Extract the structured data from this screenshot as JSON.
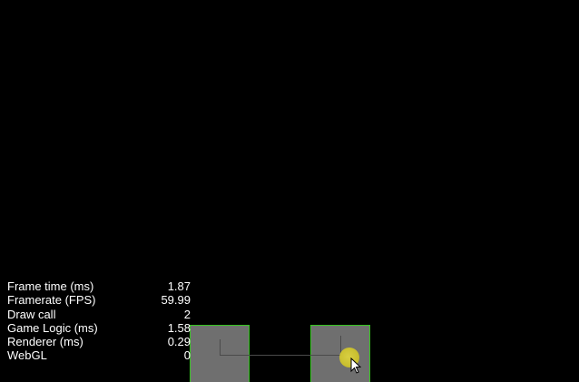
{
  "stats": {
    "rows": [
      {
        "label": "Frame time (ms)",
        "value": "1.87"
      },
      {
        "label": "Framerate (FPS)",
        "value": "59.99"
      },
      {
        "label": "Draw call",
        "value": "2"
      },
      {
        "label": "Game Logic (ms)",
        "value": "1.58"
      },
      {
        "label": "Renderer (ms)",
        "value": "0.29"
      },
      {
        "label": "WebGL",
        "value": "0"
      }
    ]
  },
  "colors": {
    "background": "#000000",
    "block_fill": "#6f6f6f",
    "block_border": "#35c41f",
    "ball": "#c9bf2f",
    "text": "#ffffff"
  },
  "icons": {
    "cursor": "mouse-pointer-icon"
  }
}
